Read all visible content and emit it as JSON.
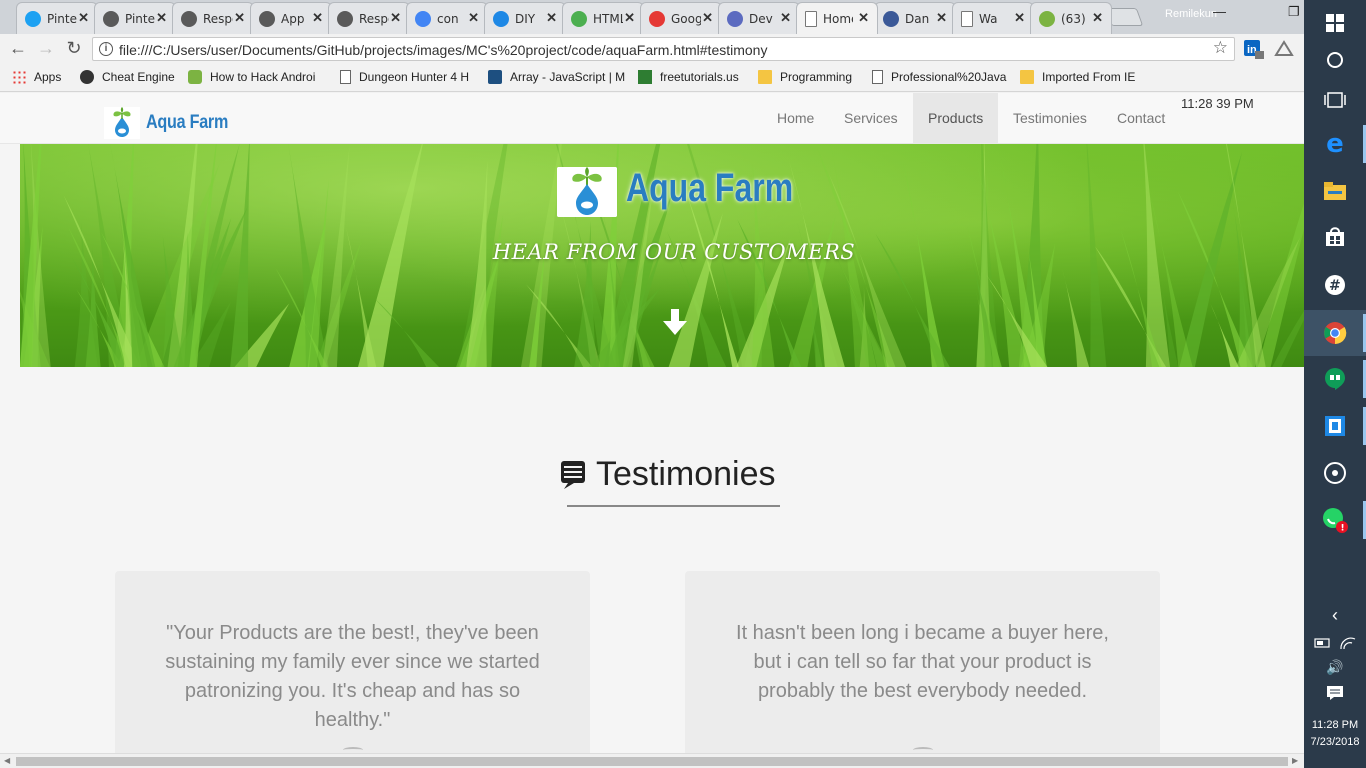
{
  "browser": {
    "tabs": [
      {
        "label": "Pinterest",
        "color": "#1da1f2"
      },
      {
        "label": "Pinterest",
        "color": "#5a5a5a"
      },
      {
        "label": "Responsive",
        "color": "#5a5a5a"
      },
      {
        "label": "App",
        "color": "#5a5a5a"
      },
      {
        "label": "Responsive",
        "color": "#5a5a5a"
      },
      {
        "label": "con",
        "color": "#4285f4"
      },
      {
        "label": "DIY",
        "color": "#1e88e5"
      },
      {
        "label": "HTML",
        "color": "#4caf50"
      },
      {
        "label": "Google",
        "color": "#e53935"
      },
      {
        "label": "Dev",
        "color": "#5c6bc0"
      },
      {
        "label": "Home",
        "color": "#ffffff",
        "active": true
      },
      {
        "label": "Dan",
        "color": "#3b5998"
      },
      {
        "label": "Wa",
        "color": "#ffffff"
      },
      {
        "label": "(63)",
        "color": "#7cb342"
      }
    ],
    "profile_name": "Remilekun",
    "url": "file:///C:/Users/user/Documents/GitHub/projects/images/MC's%20project/code/aquaFarm.html#testimony",
    "bookmarks": [
      {
        "label": "Apps",
        "icon": "apps-grid-icon"
      },
      {
        "label": "Cheat Engine",
        "icon": "gear-icon"
      },
      {
        "label": "How to Hack Androi",
        "icon": "android-icon"
      },
      {
        "label": "Dungeon Hunter 4 H",
        "icon": "page-icon"
      },
      {
        "label": "Array - JavaScript | M",
        "icon": "mdn-icon"
      },
      {
        "label": "freetutorials.us",
        "icon": "ftu-icon"
      },
      {
        "label": "Programming",
        "icon": "folder-icon"
      },
      {
        "label": "Professional%20Java",
        "icon": "page-icon"
      },
      {
        "label": "Imported From IE",
        "icon": "folder-icon"
      }
    ]
  },
  "site": {
    "brand": "Aqua Farm",
    "nav": [
      "Home",
      "Services",
      "Products",
      "Testimonies",
      "Contact"
    ],
    "active_nav": "Products",
    "clock": "11:28 39 PM",
    "hero": {
      "title": "Aqua Farm",
      "subtitle": "HEAR FROM OUR CUSTOMERS"
    },
    "testimonies": {
      "heading": "Testimonies",
      "quotes": [
        "\"Your Products are the best!, they've been sustaining my family ever since we started patronizing you. It's cheap and has so healthy.\"",
        "It hasn't been long i became a buyer here, but i can tell so far that your product is probably the best everybody needed."
      ]
    }
  },
  "taskbar": {
    "time": "11:28 PM",
    "date": "7/23/2018"
  },
  "colors": {
    "brand_blue": "#2a7dc1",
    "accent_green": "#58aa1b",
    "taskbar": "#2b3a4a"
  }
}
